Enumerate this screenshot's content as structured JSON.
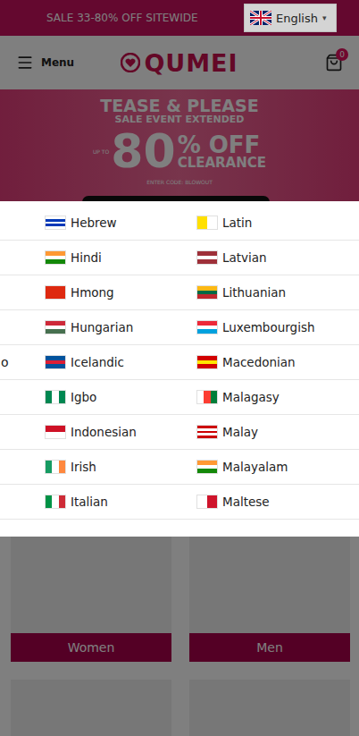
{
  "top_bar": {
    "promo": "SALE 33-80% OFF SITEWIDE",
    "language": {
      "label": "English",
      "arrow": "▾"
    }
  },
  "header": {
    "menu_label": "Menu",
    "logo": "QUMEI",
    "cart_count": "0"
  },
  "banner": {
    "title": "TEASE & PLEASE",
    "subtitle": "SALE EVENT EXTENDED",
    "up_to": "UP TO",
    "amount": "80",
    "percent_off": "% OFF",
    "clearance": "CLEARANCE",
    "code": "ENTER CODE: BLOWOUT"
  },
  "language_menu": {
    "partial_column": [
      "",
      "",
      "",
      "",
      "o",
      "",
      "",
      "",
      ""
    ],
    "left_column": [
      {
        "label": "Hebrew",
        "flag": {
          "direction": "column",
          "colors": [
            "#ffffff",
            "#0038b8",
            "#ffffff",
            "#0038b8",
            "#ffffff"
          ]
        }
      },
      {
        "label": "Hindi",
        "flag": {
          "direction": "column",
          "colors": [
            "#ff9933",
            "#ffffff",
            "#138808"
          ]
        }
      },
      {
        "label": "Hmong",
        "flag": {
          "direction": "column",
          "colors": [
            "#de2910"
          ]
        }
      },
      {
        "label": "Hungarian",
        "flag": {
          "direction": "column",
          "colors": [
            "#ce2939",
            "#ffffff",
            "#477050"
          ]
        }
      },
      {
        "label": "Icelandic",
        "flag": {
          "direction": "column",
          "colors": [
            "#02529c",
            "#dc1e35",
            "#02529c"
          ]
        }
      },
      {
        "label": "Igbo",
        "flag": {
          "direction": "row",
          "colors": [
            "#008751",
            "#ffffff",
            "#008751"
          ]
        }
      },
      {
        "label": "Indonesian",
        "flag": {
          "direction": "column",
          "colors": [
            "#ce1126",
            "#ffffff"
          ]
        }
      },
      {
        "label": "Irish",
        "flag": {
          "direction": "row",
          "colors": [
            "#169b62",
            "#ffffff",
            "#ff883e"
          ]
        }
      },
      {
        "label": "Italian",
        "flag": {
          "direction": "row",
          "colors": [
            "#009246",
            "#ffffff",
            "#ce2b37"
          ]
        }
      }
    ],
    "right_column": [
      {
        "label": "Latin",
        "flag": {
          "direction": "row",
          "colors": [
            "#ffe000",
            "#ffffff"
          ]
        }
      },
      {
        "label": "Latvian",
        "flag": {
          "direction": "column",
          "colors": [
            "#9e3039",
            "#ffffff",
            "#9e3039"
          ]
        }
      },
      {
        "label": "Lithuanian",
        "flag": {
          "direction": "column",
          "colors": [
            "#fdb913",
            "#006a44",
            "#c1272d"
          ]
        }
      },
      {
        "label": "Luxembourgish",
        "flag": {
          "direction": "column",
          "colors": [
            "#ed2939",
            "#ffffff",
            "#00a1de"
          ]
        }
      },
      {
        "label": "Macedonian",
        "flag": {
          "direction": "column",
          "colors": [
            "#d20000",
            "#ffe600",
            "#d20000"
          ]
        }
      },
      {
        "label": "Malagasy",
        "flag": {
          "direction": "row",
          "colors": [
            "#ffffff",
            "#fc3d32",
            "#007e3a"
          ]
        }
      },
      {
        "label": "Malay",
        "flag": {
          "direction": "column",
          "colors": [
            "#cc0001",
            "#ffffff",
            "#cc0001",
            "#ffffff",
            "#cc0001"
          ]
        }
      },
      {
        "label": "Malayalam",
        "flag": {
          "direction": "column",
          "colors": [
            "#ff9933",
            "#ffffff",
            "#138808"
          ]
        }
      },
      {
        "label": "Maltese",
        "flag": {
          "direction": "row",
          "colors": [
            "#ffffff",
            "#cf142b"
          ]
        }
      }
    ]
  },
  "categories": [
    {
      "label": "Women"
    },
    {
      "label": "Men"
    }
  ]
}
